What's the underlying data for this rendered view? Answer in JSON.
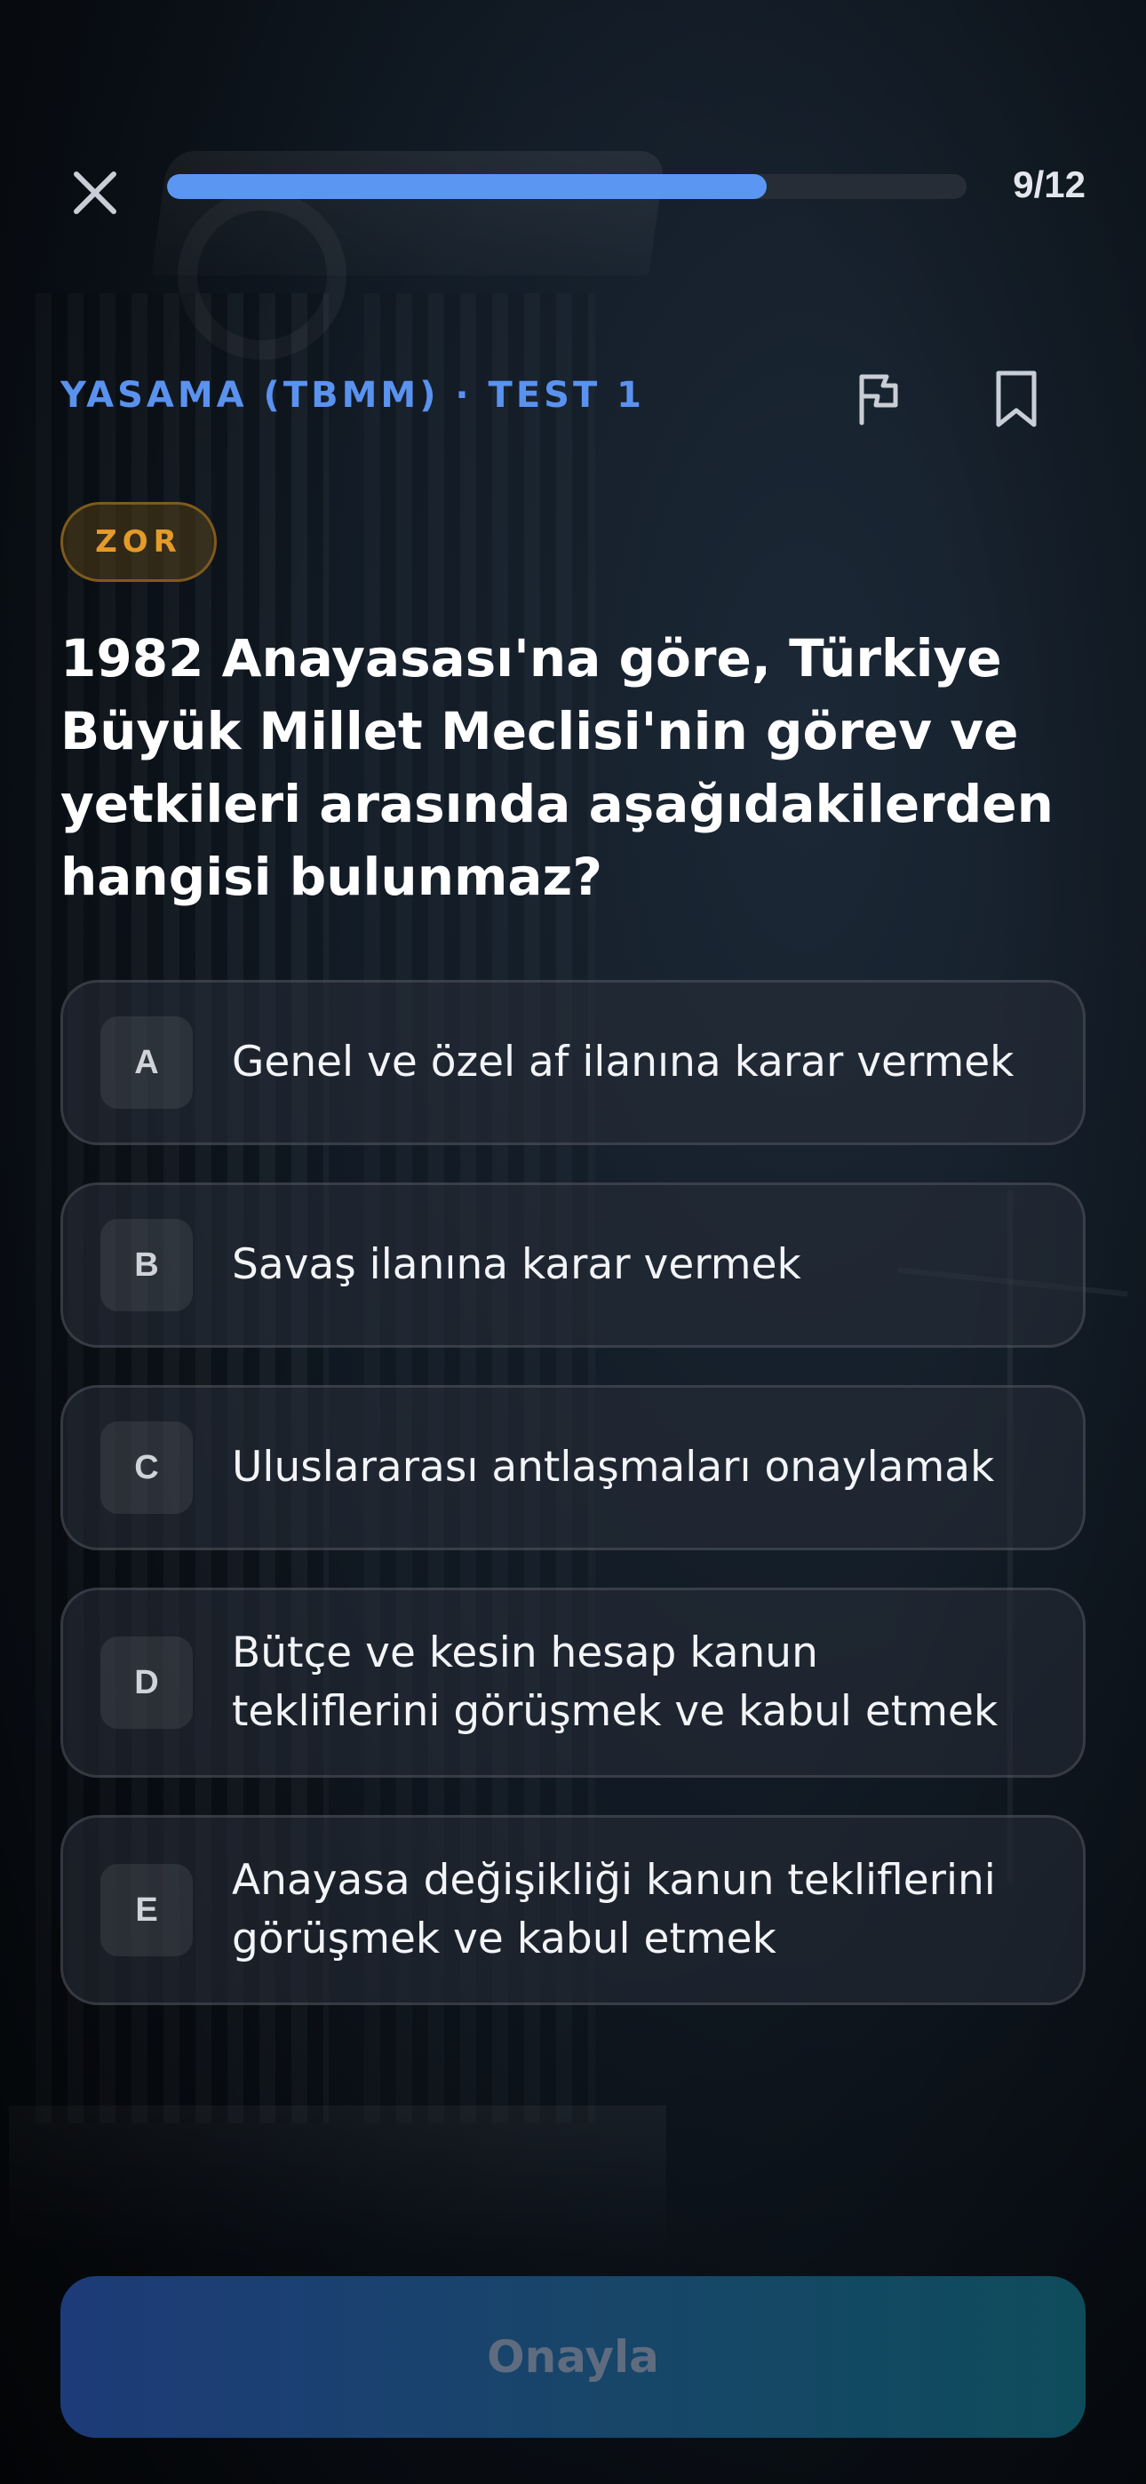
{
  "progress": {
    "current": 9,
    "total": 12,
    "label": "9/12",
    "fraction": 0.75
  },
  "header": {
    "breadcrumb": "YASAMA (TBMM) · TEST 1"
  },
  "difficulty": {
    "label": "ZOR",
    "color": "#e49b2a"
  },
  "question": {
    "text": "1982 Anayasası'na göre, Türkiye Büyük Millet Meclisi'nin görev ve yetkileri arasında aşağıdakilerden hangisi bulunmaz?"
  },
  "options": [
    {
      "letter": "A",
      "text": "Genel ve özel af ilanına karar vermek"
    },
    {
      "letter": "B",
      "text": "Savaş ilanına karar vermek"
    },
    {
      "letter": "C",
      "text": "Uluslararası antlaşmaları onaylamak"
    },
    {
      "letter": "D",
      "text": "Bütçe ve kesin hesap kanun tekliflerini görüşmek ve kabul etmek"
    },
    {
      "letter": "E",
      "text": "Anayasa değişikliği kanun tekliflerini görüşmek ve kabul etmek"
    }
  ],
  "actions": {
    "confirm_label": "Onayla"
  },
  "icons": {
    "close": "close-icon",
    "flag": "flag-icon",
    "bookmark": "bookmark-icon"
  },
  "colors": {
    "accent": "#5b97f2",
    "badge": "#e49b2a"
  }
}
